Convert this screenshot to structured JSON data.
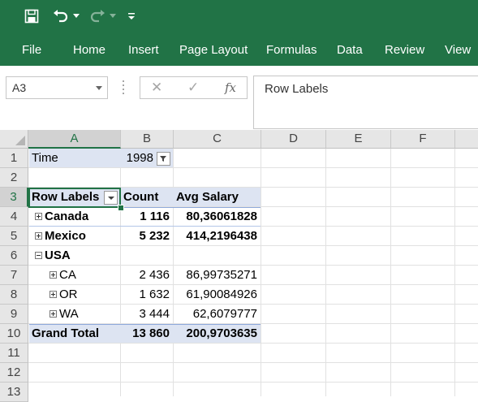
{
  "app": {
    "accent": "#217346"
  },
  "qat": {
    "icons": [
      "save-icon",
      "undo-icon",
      "redo-icon",
      "customize-qat-icon"
    ]
  },
  "ribbon": {
    "tabs": [
      "File",
      "Home",
      "Insert",
      "Page Layout",
      "Formulas",
      "Data",
      "Review",
      "View"
    ]
  },
  "namebox": {
    "value": "A3"
  },
  "formula_bar": {
    "cancel_icon": "✕",
    "enter_icon": "✓",
    "fx_label": "fx",
    "content": "Row Labels"
  },
  "columns": [
    "A",
    "B",
    "C",
    "D",
    "E",
    "F"
  ],
  "rows": [
    "1",
    "2",
    "3",
    "4",
    "5",
    "6",
    "7",
    "8",
    "9",
    "10",
    "11",
    "12",
    "13"
  ],
  "pivot": {
    "filter": {
      "label": "Time",
      "value": "1998"
    },
    "headers": {
      "row_labels": "Row Labels",
      "count": "Count",
      "avg_salary": "Avg Salary"
    },
    "items": [
      {
        "label": "Canada",
        "count": "1 116",
        "avg": "80,36061828"
      },
      {
        "label": "Mexico",
        "count": "5 232",
        "avg": "414,2196438"
      },
      {
        "label": "USA",
        "count": "",
        "avg": ""
      },
      {
        "label": "CA",
        "count": "2 436",
        "avg": "86,99735271"
      },
      {
        "label": "OR",
        "count": "1 632",
        "avg": "61,90084926"
      },
      {
        "label": "WA",
        "count": "3 444",
        "avg": "62,6079777"
      }
    ],
    "grand_total": {
      "label": "Grand Total",
      "count": "13 860",
      "avg": "200,9703635"
    }
  }
}
